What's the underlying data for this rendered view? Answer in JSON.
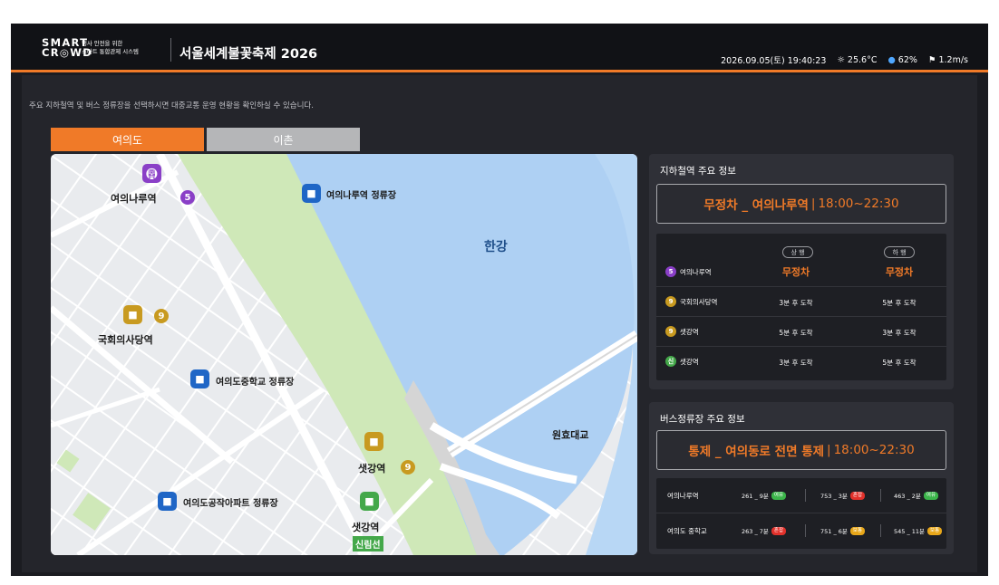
{
  "header": {
    "logo_line1": "SMART",
    "logo_line2": "CR◎WD",
    "logo_sub1": "행사 안전을 위한",
    "logo_sub2": "스마트 통합관제 시스템",
    "event_title": "서울세계불꽃축제 2026",
    "datetime": "2026.09.05(토) 19:40:23",
    "temperature": "25.6°C",
    "humidity": "62%",
    "wind": "1.2m/s"
  },
  "notice": "주요 지하철역 및 버스 정류장을 선택하시면 대중교통 운영 현황을 확인하실 수 있습니다.",
  "tabs": [
    {
      "label": "여의도",
      "active": true
    },
    {
      "label": "이촌",
      "active": false
    }
  ],
  "map": {
    "river_label": "한강",
    "bridge_label": "원효대교",
    "markers": {
      "yeouinaru_station": "여의나루역",
      "yeouinaru_line": "5",
      "yeouinaru_bus": "여의나루역 정류장",
      "assembly_station": "국회의사당역",
      "assembly_line": "9",
      "middle_school_bus": "여의도중학교 정류장",
      "saetgang_station_9": "샛강역",
      "saetgang_line_9": "9",
      "apartment_bus": "여의도공작아파트 정류장",
      "saetgang_station_sin": "샛강역",
      "sinrim_tag": "신림선"
    }
  },
  "subway_panel": {
    "title": "지하철역 주요 정보",
    "alert_strong": "무정차 _ 여의나루역",
    "alert_sep": "|",
    "alert_time": "18:00~22:30",
    "dir_up": "상 행",
    "dir_down": "하 행",
    "rows": [
      {
        "line": "5",
        "line_color": "#8a3fc7",
        "station": "여의나루역",
        "up": "무정차",
        "down": "무정차"
      },
      {
        "line": "9",
        "line_color": "#c89a20",
        "station": "국회의사당역",
        "up": "3분 후 도착",
        "down": "5분 후 도착"
      },
      {
        "line": "9",
        "line_color": "#c89a20",
        "station": "샛강역",
        "up": "5분 후 도착",
        "down": "3분 후 도착"
      },
      {
        "line": "신",
        "line_color": "#44a84a",
        "station": "샛강역",
        "up": "3분 후 도착",
        "down": "5분 후 도착"
      }
    ]
  },
  "bus_panel": {
    "title": "버스정류장 주요 정보",
    "alert_strong": "통제 _ 여의동로 전면 통제",
    "alert_sep": "|",
    "alert_time": "18:00~22:30",
    "rows": [
      {
        "station": "여의나루역",
        "buses": [
          {
            "text": "261 _ 9분",
            "badge": "여유",
            "badge_color": "#3bb54a"
          },
          {
            "text": "753 _ 3분",
            "badge": "혼잡",
            "badge_color": "#e2312b"
          },
          {
            "text": "463 _ 2분",
            "badge": "여유",
            "badge_color": "#3bb54a"
          }
        ]
      },
      {
        "station": "여의도 중학교",
        "buses": [
          {
            "text": "263 _ 7분",
            "badge": "혼잡",
            "badge_color": "#e2312b"
          },
          {
            "text": "751 _ 6분",
            "badge": "보통",
            "badge_color": "#e8a71a"
          },
          {
            "text": "545 _ 11분",
            "badge": "보통",
            "badge_color": "#e8a71a"
          }
        ]
      }
    ]
  },
  "colors": {
    "accent": "#f07a28",
    "bus": "#1f66c6",
    "line5": "#8a3fc7",
    "line9": "#c89a20",
    "sinrim": "#44a84a"
  }
}
